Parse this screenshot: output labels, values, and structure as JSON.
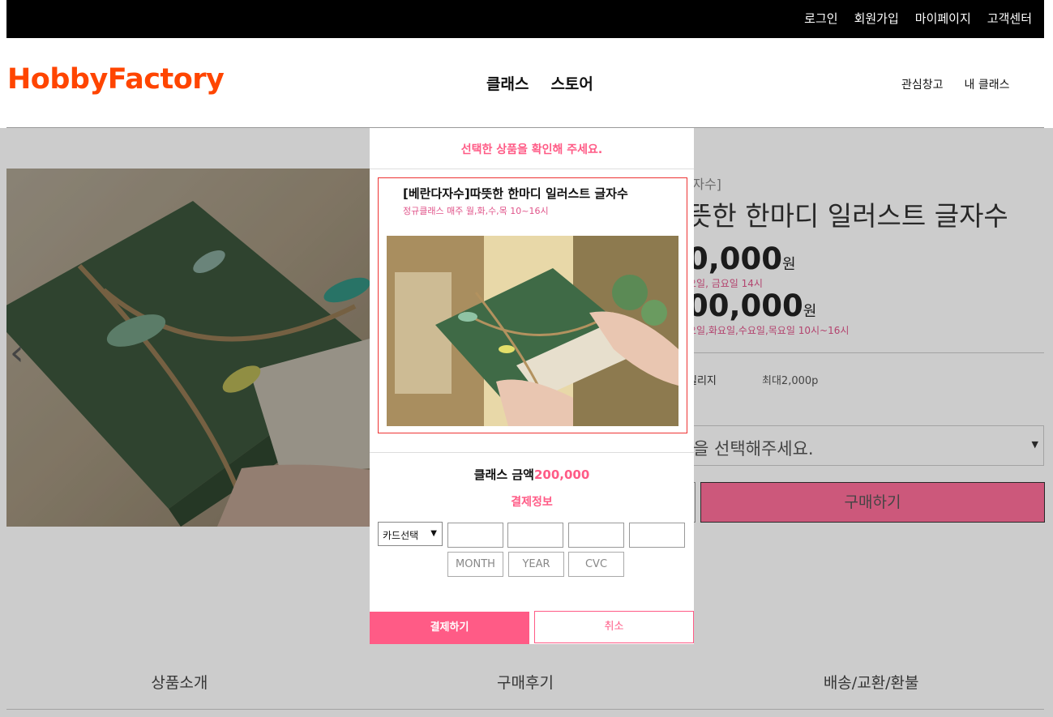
{
  "topbar": {
    "links": [
      "로그인",
      "회원가입",
      "마이페이지",
      "고객센터"
    ]
  },
  "header": {
    "logo": "HobbyFactory",
    "main_nav": [
      "클래스",
      "스토어"
    ],
    "sub_nav": [
      "관심창고",
      "내 클래스"
    ]
  },
  "product": {
    "category": "[자수]",
    "title": "뜻한 한마디 일러스트 글자수",
    "price1": "0,000",
    "price_unit": "원",
    "schedule1": "요일, 금요일 14시",
    "price2": "00,000",
    "schedule2": "요일,화요일,수요일,목요일 10시~16시",
    "mileage_label": "일리지",
    "mileage_value": "최대2,000p",
    "option_placeholder": "을 선택해주세요.",
    "buy_label": "구매하기",
    "carousel_arrow": "‹"
  },
  "tabs": [
    "상품소개",
    "구매후기",
    "배송/교환/환불"
  ],
  "modal": {
    "heading": "선택한 상품을 확인해 주세요.",
    "item_title": "[베란다자수]따뜻한 한마디 일러스트 글자수",
    "item_schedule": "정규클래스 매주 월,화,수,목 10~16시",
    "amount_label": "클래스 금액",
    "amount_value": "200,000",
    "payment_info": "결제정보",
    "card_select": "카드선택",
    "month_placeholder": "MONTH",
    "year_placeholder": "YEAR",
    "cvc_placeholder": "CVC",
    "pay_label": "결제하기",
    "cancel_label": "취소"
  },
  "colors": {
    "brand": "#ff4500",
    "accent": "#ff5b86",
    "schedule": "#e0548a"
  }
}
